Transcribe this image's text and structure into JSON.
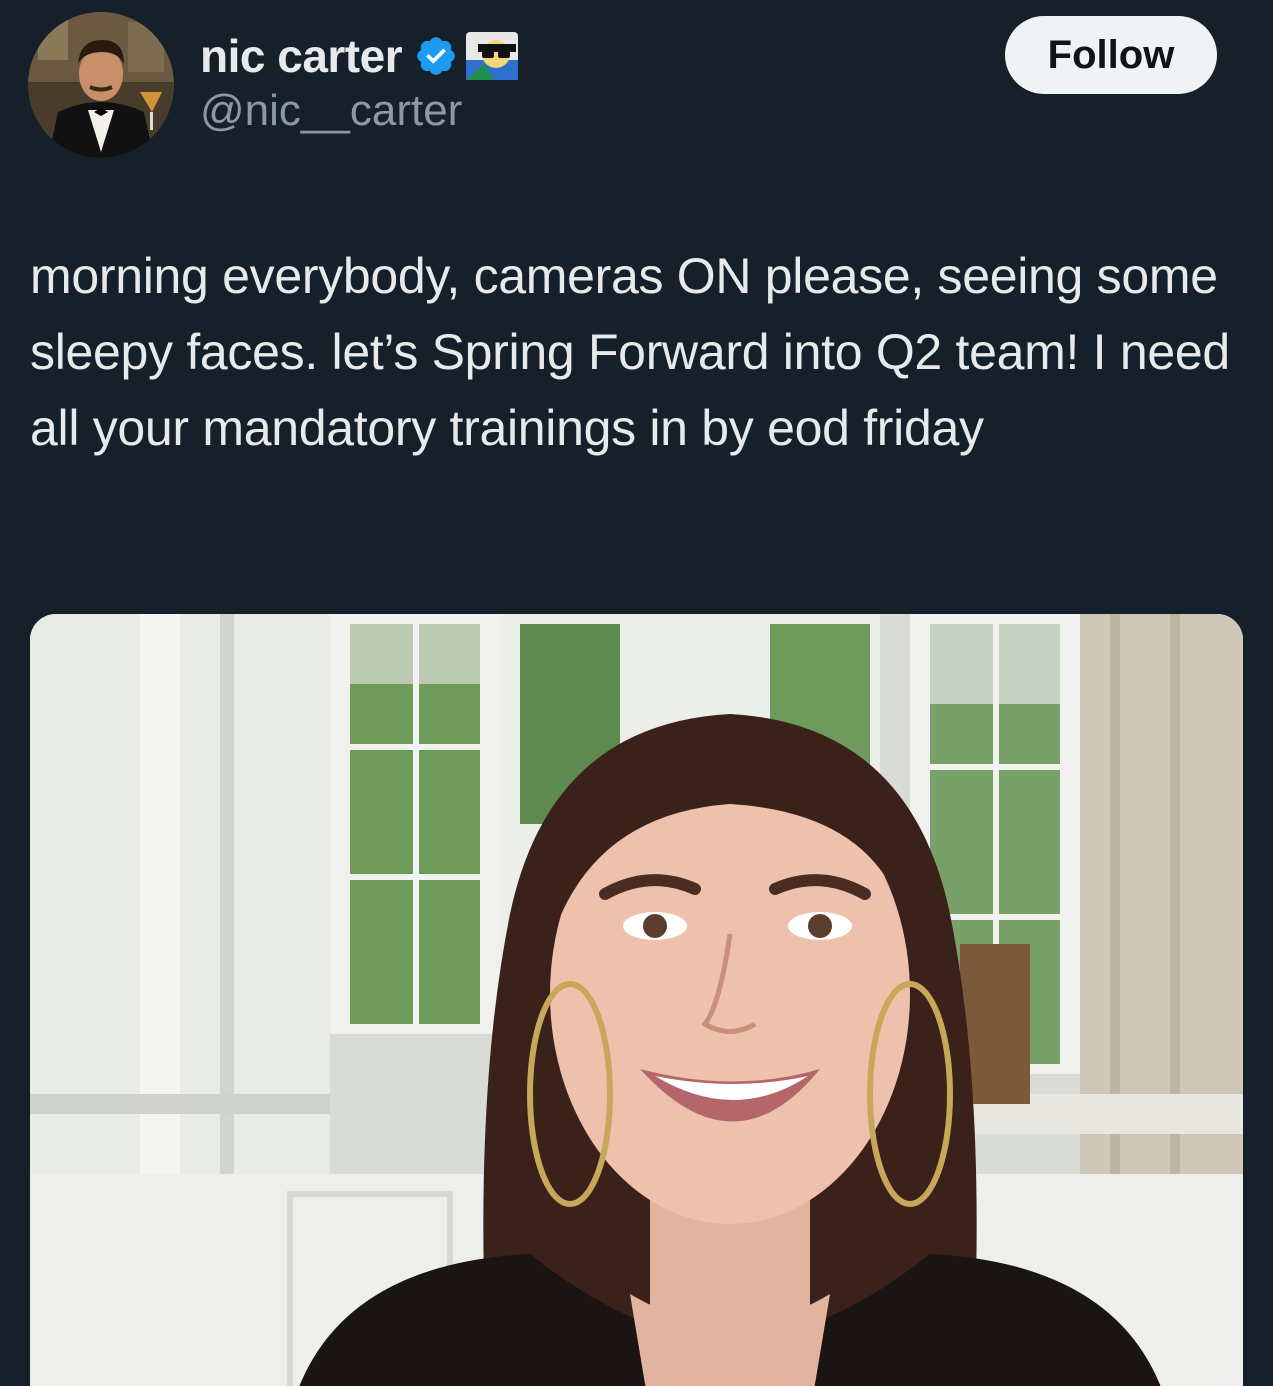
{
  "author": {
    "display_name": "nic carter",
    "handle": "@nic__carter",
    "avatar_icon": "profile-photo",
    "badges": [
      "verified-badge-icon",
      "sunglasses-emoji-icon"
    ],
    "verified_color": "#1d9bf0"
  },
  "follow_button": {
    "label": "Follow"
  },
  "tweet": {
    "text": "morning everybody, cameras ON please, seeing some sleepy faces. let’s Spring Forward into Q2 team! I need all your mandatory trainings in by eod friday"
  },
  "media": {
    "icon": "attached-photo"
  },
  "colors": {
    "background": "#15202b",
    "text_primary": "#e7e9ea",
    "text_secondary": "#8b98a5",
    "button_bg": "#eff3f4",
    "button_text": "#0f1419"
  }
}
